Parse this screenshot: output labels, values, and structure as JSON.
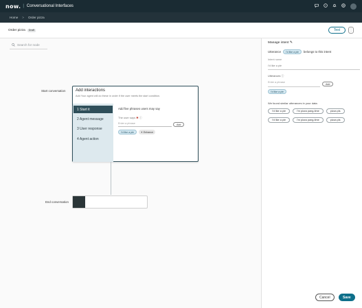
{
  "header": {
    "logo": "now.",
    "app_title": "Conversational Interfaces",
    "icons": [
      "chat-icon",
      "help-icon",
      "notifications-icon",
      "globe-icon"
    ]
  },
  "breadcrumb": {
    "home": "Home",
    "separator": ">",
    "current": "Order pizza"
  },
  "titlebar": {
    "title": "Order pizza",
    "badge": "Draft",
    "test_label": "Test",
    "more_label": "⋮"
  },
  "canvas": {
    "search_placeholder": "Search for node",
    "start_label": "Start conversation",
    "end_label": "End conversation"
  },
  "interactions_card": {
    "title": "Add interactions",
    "subtitle": "Add Your agent will do these in order if the user meets the start condition.",
    "steps": [
      {
        "label": "1  Start it",
        "active": true
      },
      {
        "label": "2  Agent message",
        "active": false
      },
      {
        "label": "3  User response",
        "active": false
      },
      {
        "label": "4  Agent action",
        "active": false
      }
    ],
    "body_title": "Add five phrases users may say",
    "user_says": "The user says",
    "phrase_placeholder": "Enter a phrase",
    "add_label": "Add",
    "chip_phrase": "I'd like a pie",
    "enhance_label": "Enhance"
  },
  "panel": {
    "title": "Manage intent",
    "utterance_label": "Utterance",
    "utterance_chip": "I'd like a pie",
    "belongs_text": "belongs to this intent",
    "intent_name_label": "Intent name",
    "intent_name_value": "I'd like a pie",
    "utterances_label": "Utterances",
    "utterance_placeholder": "Enter a phrase",
    "add_label": "Add",
    "utterance_chip2": "I'd like a pie",
    "similar_title": "We found similar utterances in your data:",
    "similar_row1": [
      "I'd like a pie",
      "I'm pizza pang-time",
      "pizza pls"
    ],
    "similar_row2": [
      "I'd like a pie",
      "I'm pizza pang-time",
      "pizza pls"
    ],
    "cancel_label": "Cancel",
    "save_label": "Save"
  }
}
